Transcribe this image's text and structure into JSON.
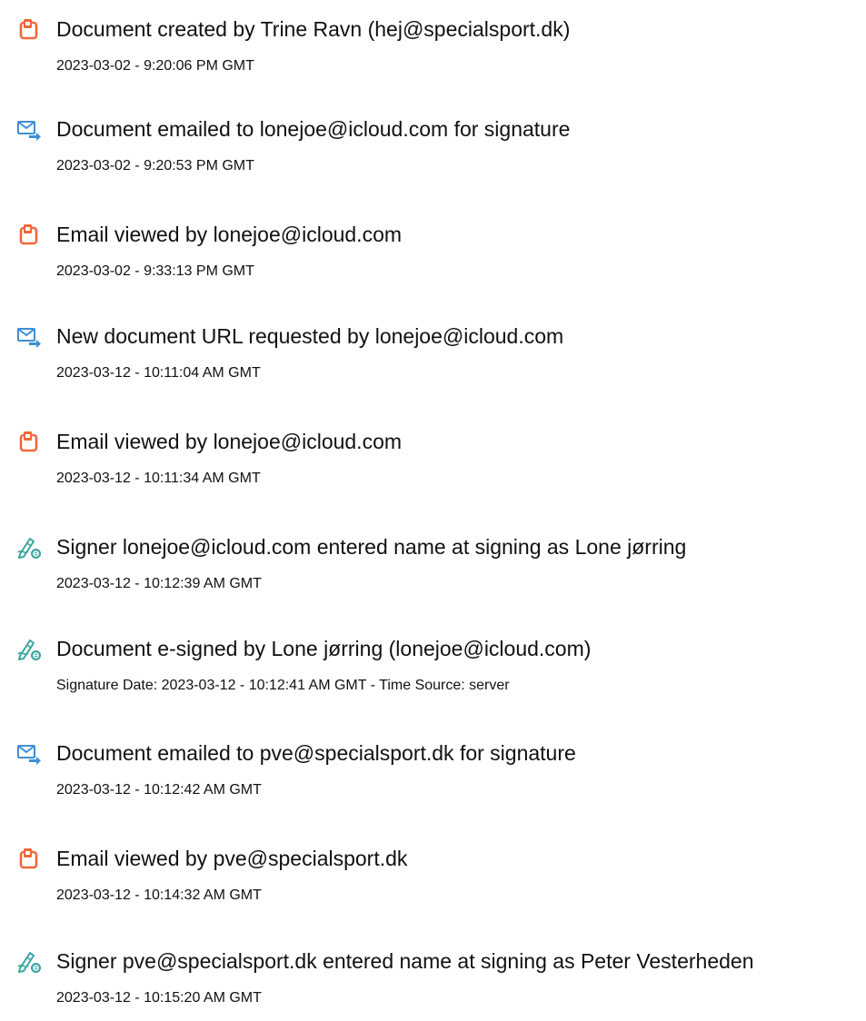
{
  "colors": {
    "doc_icon": "#f0673a",
    "email_icon": "#3d8fd6",
    "sign_icon": "#3aa6a0"
  },
  "events": [
    {
      "icon": "document-icon",
      "text": "Document created by Trine Ravn (hej@specialsport.dk)",
      "time": "2023-03-02 - 9:20:06 PM GMT"
    },
    {
      "icon": "email-forward-icon",
      "text": "Document emailed to lonejoe@icloud.com for signature",
      "time": "2023-03-02 - 9:20:53 PM GMT"
    },
    {
      "icon": "document-icon",
      "text": "Email viewed by lonejoe@icloud.com",
      "time": "2023-03-02 - 9:33:13 PM GMT"
    },
    {
      "icon": "email-forward-icon",
      "text": "New document URL requested by lonejoe@icloud.com",
      "time": "2023-03-12 - 10:11:04 AM GMT"
    },
    {
      "icon": "document-icon",
      "text": "Email viewed by lonejoe@icloud.com",
      "time": "2023-03-12 - 10:11:34 AM GMT"
    },
    {
      "icon": "esign-pen-icon",
      "text": "Signer lonejoe@icloud.com entered name at signing as Lone jørring",
      "time": "2023-03-12 - 10:12:39 AM GMT"
    },
    {
      "icon": "esign-pen-icon",
      "text": "Document e-signed by Lone jørring (lonejoe@icloud.com)",
      "time": "Signature Date: 2023-03-12 - 10:12:41 AM GMT - Time Source: server"
    },
    {
      "icon": "email-forward-icon",
      "text": "Document emailed to pve@specialsport.dk for signature",
      "time": "2023-03-12 - 10:12:42 AM GMT"
    },
    {
      "icon": "document-icon",
      "text": "Email viewed by pve@specialsport.dk",
      "time": "2023-03-12 - 10:14:32 AM GMT"
    },
    {
      "icon": "esign-pen-icon",
      "text": "Signer pve@specialsport.dk entered name at signing as Peter Vesterheden",
      "time": "2023-03-12 - 10:15:20 AM GMT"
    }
  ]
}
